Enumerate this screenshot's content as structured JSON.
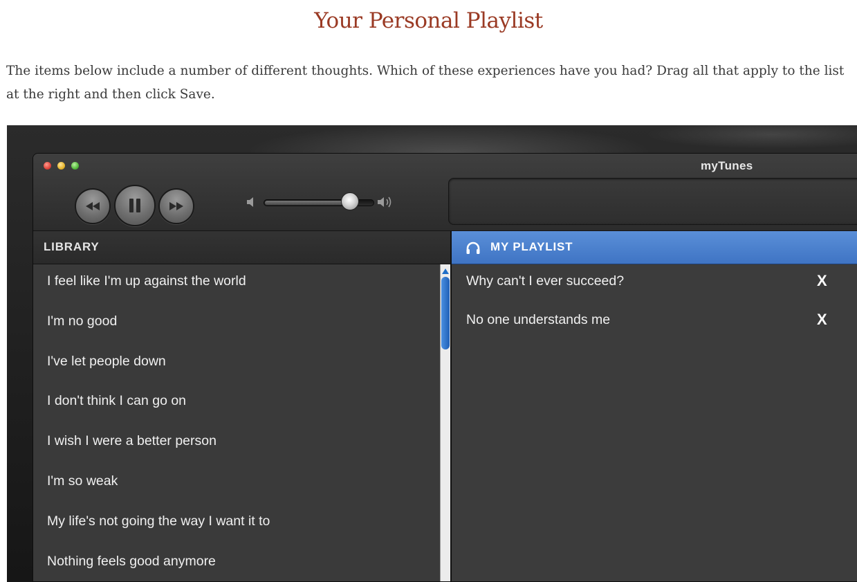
{
  "page": {
    "title": "Your Personal Playlist",
    "instructions": "The items below include a number of different thoughts. Which of these experiences have you had? Drag all that apply to the list at the right and then click Save."
  },
  "window": {
    "title": "myTunes",
    "controls": {
      "rewind_icon": "rewind-icon",
      "pause_icon": "pause-icon",
      "forward_icon": "fast-forward-icon",
      "volume_level": 0.78
    }
  },
  "library": {
    "header": "LIBRARY",
    "items": [
      "I feel like I'm up against the world",
      "I'm no good",
      "I've let people down",
      "I don't think I can go on",
      "I wish I were a better person",
      "I'm so weak",
      "My life's not going the way I want it to",
      "Nothing feels good anymore"
    ]
  },
  "playlist": {
    "header": "MY PLAYLIST",
    "header_icon": "headphones-icon",
    "remove_label": "X",
    "items": [
      "Why can't I ever succeed?",
      "No one understands me"
    ]
  },
  "colors": {
    "title": "#9a3a24",
    "playlist_header": "#4a80cc",
    "library_bg": "#3a3a3a"
  }
}
